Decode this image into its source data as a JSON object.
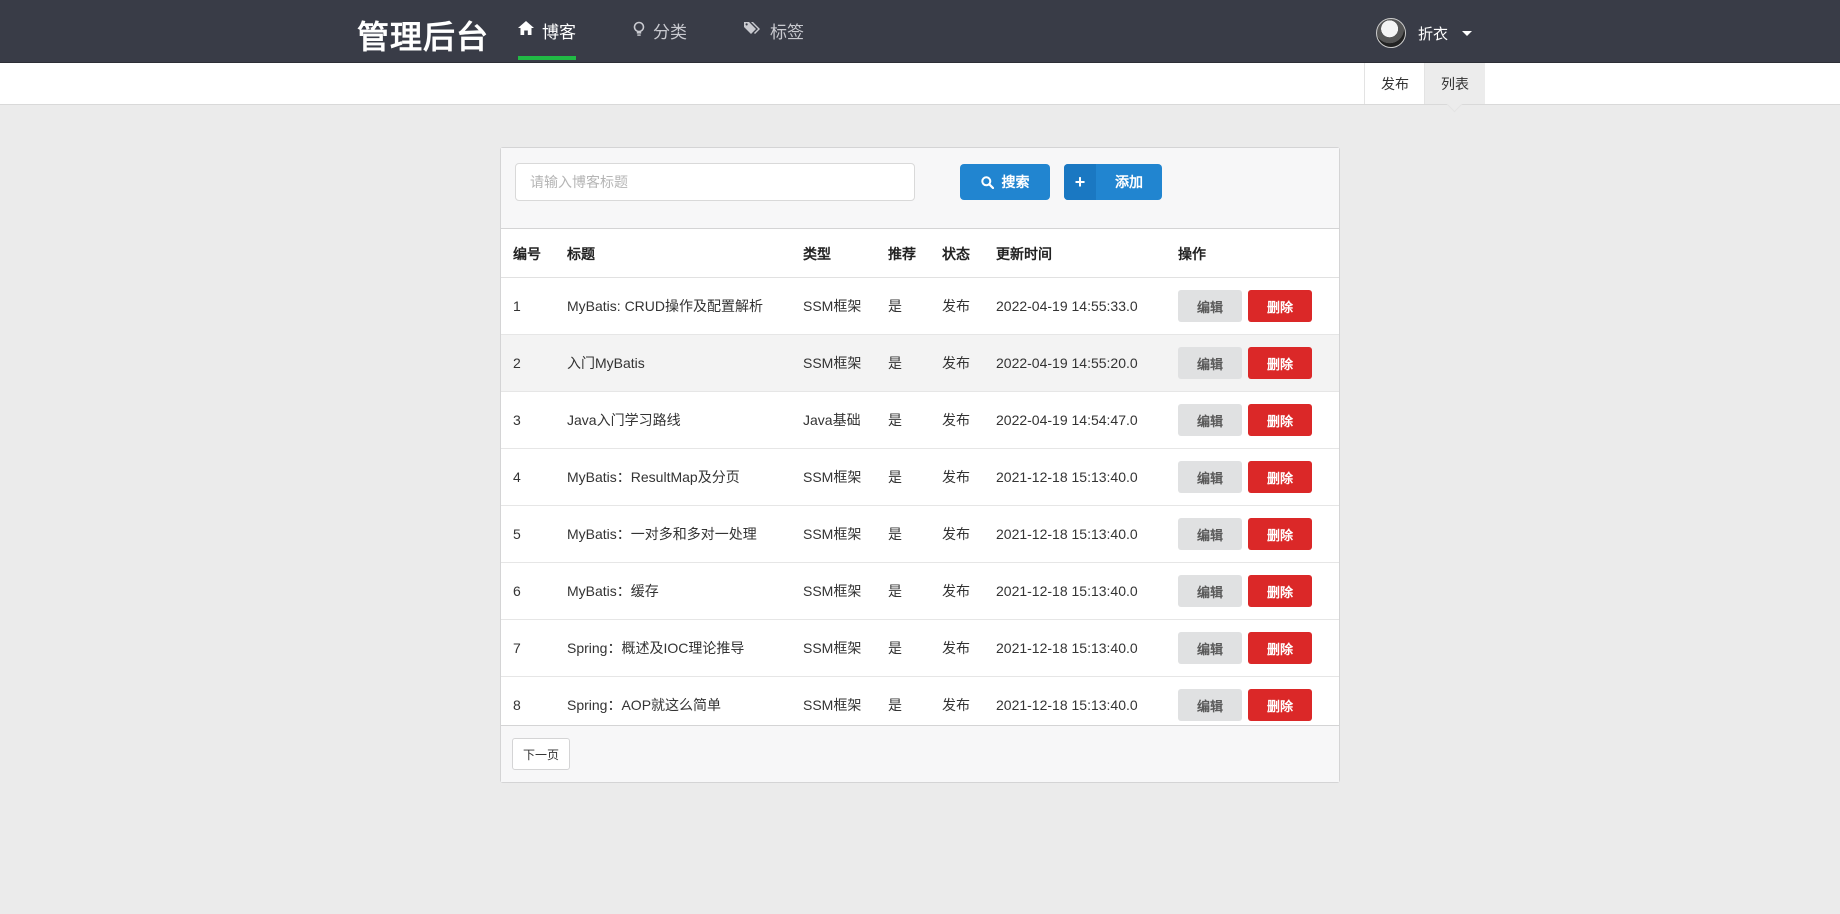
{
  "app": {
    "title": "管理后台"
  },
  "nav": {
    "items": [
      {
        "label": "博客",
        "icon": "home-icon"
      },
      {
        "label": "分类",
        "icon": "lightbulb-icon"
      },
      {
        "label": "标签",
        "icon": "tags-icon"
      }
    ],
    "active": "博客"
  },
  "user": {
    "name": "折衣"
  },
  "submenu": {
    "publish": "发布",
    "list": "列表",
    "active": "列表"
  },
  "search": {
    "placeholder": "请输入博客标题",
    "value": "",
    "search_label": "搜索",
    "add_label": "添加"
  },
  "table": {
    "headers": [
      "编号",
      "标题",
      "类型",
      "推荐",
      "状态",
      "更新时间",
      "操作"
    ],
    "rows": [
      {
        "id": "1",
        "title": "MyBatis: CRUD操作及配置解析",
        "type": "SSM框架",
        "recommend": "是",
        "status": "发布",
        "updated": "2022-04-19 14:55:33.0"
      },
      {
        "id": "2",
        "title": "入门MyBatis",
        "type": "SSM框架",
        "recommend": "是",
        "status": "发布",
        "updated": "2022-04-19 14:55:20.0"
      },
      {
        "id": "3",
        "title": "Java入门学习路线",
        "type": "Java基础",
        "recommend": "是",
        "status": "发布",
        "updated": "2022-04-19 14:54:47.0"
      },
      {
        "id": "4",
        "title": "MyBatis：ResultMap及分页",
        "type": "SSM框架",
        "recommend": "是",
        "status": "发布",
        "updated": "2021-12-18 15:13:40.0"
      },
      {
        "id": "5",
        "title": "MyBatis：一对多和多对一处理",
        "type": "SSM框架",
        "recommend": "是",
        "status": "发布",
        "updated": "2021-12-18 15:13:40.0"
      },
      {
        "id": "6",
        "title": "MyBatis：缓存",
        "type": "SSM框架",
        "recommend": "是",
        "status": "发布",
        "updated": "2021-12-18 15:13:40.0"
      },
      {
        "id": "7",
        "title": "Spring：概述及IOC理论推导",
        "type": "SSM框架",
        "recommend": "是",
        "status": "发布",
        "updated": "2021-12-18 15:13:40.0"
      },
      {
        "id": "8",
        "title": "Spring：AOP就这么简单",
        "type": "SSM框架",
        "recommend": "是",
        "status": "发布",
        "updated": "2021-12-18 15:13:40.0"
      }
    ],
    "edit_label": "编辑",
    "delete_label": "删除"
  },
  "pagination": {
    "next_label": "下一页"
  },
  "colors": {
    "nav_bg": "#393c47",
    "active_underline": "#21ba45",
    "primary": "#2185d0",
    "danger": "#db2828"
  }
}
